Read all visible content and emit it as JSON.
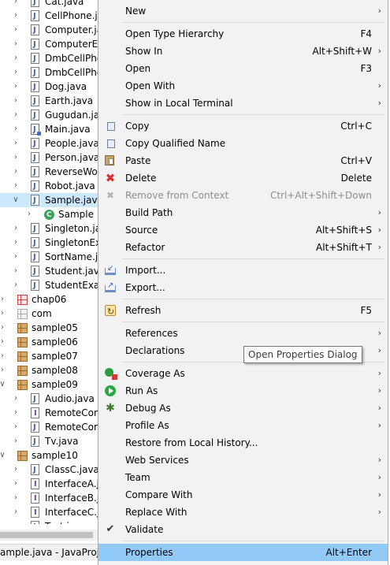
{
  "tree": {
    "items": [
      {
        "label": "Cat.java",
        "indent": 2,
        "icon": "java-file-icon",
        "expanded": false
      },
      {
        "label": "CellPhone.java",
        "indent": 2,
        "icon": "java-file-icon",
        "expanded": false
      },
      {
        "label": "Computer.java",
        "indent": 2,
        "icon": "java-file-icon",
        "expanded": false
      },
      {
        "label": "ComputerEx.java",
        "indent": 2,
        "icon": "java-file-icon",
        "expanded": false
      },
      {
        "label": "DmbCellPhone.java",
        "indent": 2,
        "icon": "java-file-icon",
        "expanded": false
      },
      {
        "label": "DmbCellPhoneEx.java",
        "indent": 2,
        "icon": "java-file-icon",
        "expanded": false
      },
      {
        "label": "Dog.java",
        "indent": 2,
        "icon": "java-file-icon",
        "expanded": false
      },
      {
        "label": "Earth.java",
        "indent": 2,
        "icon": "java-file-icon",
        "expanded": false
      },
      {
        "label": "Gugudan.java",
        "indent": 2,
        "icon": "java-file-icon",
        "expanded": false
      },
      {
        "label": "Main.java",
        "indent": 2,
        "icon": "java-main-file-icon",
        "expanded": false
      },
      {
        "label": "People.java",
        "indent": 2,
        "icon": "java-file-icon",
        "expanded": false
      },
      {
        "label": "Person.java",
        "indent": 2,
        "icon": "java-file-icon",
        "expanded": false
      },
      {
        "label": "ReverseWord.java",
        "indent": 2,
        "icon": "java-file-icon",
        "expanded": false
      },
      {
        "label": "Robot.java",
        "indent": 2,
        "icon": "java-file-icon",
        "expanded": false
      },
      {
        "label": "Sample.java",
        "indent": 2,
        "icon": "java-file-icon",
        "expanded": true,
        "selected": true
      },
      {
        "label": "Sample",
        "indent": 3,
        "icon": "class-icon",
        "expanded": false
      },
      {
        "label": "Singleton.java",
        "indent": 2,
        "icon": "java-file-icon",
        "expanded": false
      },
      {
        "label": "SingletonEx.java",
        "indent": 2,
        "icon": "java-file-icon",
        "expanded": false
      },
      {
        "label": "SortName.java",
        "indent": 2,
        "icon": "java-file-icon",
        "expanded": false
      },
      {
        "label": "Student.java",
        "indent": 2,
        "icon": "java-file-icon",
        "expanded": false
      },
      {
        "label": "StudentExample.java",
        "indent": 2,
        "icon": "java-file-icon",
        "expanded": false
      },
      {
        "label": "chap06",
        "indent": 1,
        "icon": "package-error-icon",
        "expanded": false
      },
      {
        "label": "com",
        "indent": 1,
        "icon": "empty-package-icon",
        "expanded": false
      },
      {
        "label": "sample05",
        "indent": 1,
        "icon": "package-icon",
        "expanded": false
      },
      {
        "label": "sample06",
        "indent": 1,
        "icon": "package-icon",
        "expanded": false
      },
      {
        "label": "sample07",
        "indent": 1,
        "icon": "package-icon",
        "expanded": false
      },
      {
        "label": "sample08",
        "indent": 1,
        "icon": "package-icon",
        "expanded": false
      },
      {
        "label": "sample09",
        "indent": 1,
        "icon": "package-icon",
        "expanded": true
      },
      {
        "label": "Audio.java",
        "indent": 2,
        "icon": "java-file-icon",
        "expanded": false
      },
      {
        "label": "RemoteControl.java",
        "indent": 2,
        "icon": "java-interface-file-icon",
        "expanded": false
      },
      {
        "label": "RemoteControlEx.java",
        "indent": 2,
        "icon": "java-file-icon",
        "expanded": false
      },
      {
        "label": "Tv.java",
        "indent": 2,
        "icon": "java-file-icon",
        "expanded": false
      },
      {
        "label": "sample10",
        "indent": 1,
        "icon": "package-icon",
        "expanded": true
      },
      {
        "label": "ClassC.java",
        "indent": 2,
        "icon": "java-file-icon",
        "expanded": false
      },
      {
        "label": "InterfaceA.java",
        "indent": 2,
        "icon": "java-interface-file-icon",
        "expanded": false
      },
      {
        "label": "InterfaceB.java",
        "indent": 2,
        "icon": "java-interface-file-icon",
        "expanded": false
      },
      {
        "label": "InterfaceC.java",
        "indent": 2,
        "icon": "java-interface-file-icon",
        "expanded": false
      },
      {
        "label": "Test.java",
        "indent": 2,
        "icon": "java-file-icon",
        "expanded": false
      }
    ]
  },
  "statusbar": {
    "text": "ample.java - JavaProject"
  },
  "menu": {
    "items": [
      {
        "type": "item",
        "label": "New",
        "accel": "",
        "submenu": true,
        "icon": ""
      },
      {
        "type": "sep"
      },
      {
        "type": "item",
        "label": "Open Type Hierarchy",
        "accel": "F4",
        "submenu": false,
        "icon": ""
      },
      {
        "type": "item",
        "label": "Show In",
        "accel": "Alt+Shift+W",
        "submenu": true,
        "icon": ""
      },
      {
        "type": "item",
        "label": "Open",
        "accel": "F3",
        "submenu": false,
        "icon": ""
      },
      {
        "type": "item",
        "label": "Open With",
        "accel": "",
        "submenu": true,
        "icon": ""
      },
      {
        "type": "item",
        "label": "Show in Local Terminal",
        "accel": "",
        "submenu": true,
        "icon": ""
      },
      {
        "type": "sep"
      },
      {
        "type": "item",
        "label": "Copy",
        "accel": "Ctrl+C",
        "submenu": false,
        "icon": "copy-icon"
      },
      {
        "type": "item",
        "label": "Copy Qualified Name",
        "accel": "",
        "submenu": false,
        "icon": "copy-qualified-name-icon"
      },
      {
        "type": "item",
        "label": "Paste",
        "accel": "Ctrl+V",
        "submenu": false,
        "icon": "paste-icon"
      },
      {
        "type": "item",
        "label": "Delete",
        "accel": "Delete",
        "submenu": false,
        "icon": "delete-icon"
      },
      {
        "type": "item",
        "label": "Remove from Context",
        "accel": "Ctrl+Alt+Shift+Down",
        "submenu": false,
        "icon": "remove-from-context-icon",
        "disabled": true
      },
      {
        "type": "item",
        "label": "Build Path",
        "accel": "",
        "submenu": true,
        "icon": ""
      },
      {
        "type": "item",
        "label": "Source",
        "accel": "Alt+Shift+S",
        "submenu": true,
        "icon": ""
      },
      {
        "type": "item",
        "label": "Refactor",
        "accel": "Alt+Shift+T",
        "submenu": true,
        "icon": ""
      },
      {
        "type": "sep"
      },
      {
        "type": "item",
        "label": "Import...",
        "accel": "",
        "submenu": false,
        "icon": "import-icon"
      },
      {
        "type": "item",
        "label": "Export...",
        "accel": "",
        "submenu": false,
        "icon": "export-icon"
      },
      {
        "type": "sep"
      },
      {
        "type": "item",
        "label": "Refresh",
        "accel": "F5",
        "submenu": false,
        "icon": "refresh-icon"
      },
      {
        "type": "sep"
      },
      {
        "type": "item",
        "label": "References",
        "accel": "",
        "submenu": true,
        "icon": ""
      },
      {
        "type": "item",
        "label": "Declarations",
        "accel": "",
        "submenu": true,
        "icon": ""
      },
      {
        "type": "sep"
      },
      {
        "type": "item",
        "label": "Coverage As",
        "accel": "",
        "submenu": true,
        "icon": "coverage-icon"
      },
      {
        "type": "item",
        "label": "Run As",
        "accel": "",
        "submenu": true,
        "icon": "run-icon"
      },
      {
        "type": "item",
        "label": "Debug As",
        "accel": "",
        "submenu": true,
        "icon": "debug-icon"
      },
      {
        "type": "item",
        "label": "Profile As",
        "accel": "",
        "submenu": true,
        "icon": ""
      },
      {
        "type": "item",
        "label": "Restore from Local History...",
        "accel": "",
        "submenu": false,
        "icon": ""
      },
      {
        "type": "item",
        "label": "Web Services",
        "accel": "",
        "submenu": true,
        "icon": ""
      },
      {
        "type": "item",
        "label": "Team",
        "accel": "",
        "submenu": true,
        "icon": ""
      },
      {
        "type": "item",
        "label": "Compare With",
        "accel": "",
        "submenu": true,
        "icon": ""
      },
      {
        "type": "item",
        "label": "Replace With",
        "accel": "",
        "submenu": true,
        "icon": ""
      },
      {
        "type": "item",
        "label": "Validate",
        "accel": "",
        "submenu": false,
        "icon": "check-icon"
      },
      {
        "type": "sep"
      },
      {
        "type": "item",
        "label": "Properties",
        "accel": "Alt+Enter",
        "submenu": false,
        "icon": "",
        "highlighted": true
      }
    ]
  },
  "tooltip": {
    "text": "Open Properties Dialog"
  },
  "colors": {
    "highlight": "#91c9f7",
    "selection": "#cce8ff",
    "menu_bg": "#f2f2f2"
  }
}
